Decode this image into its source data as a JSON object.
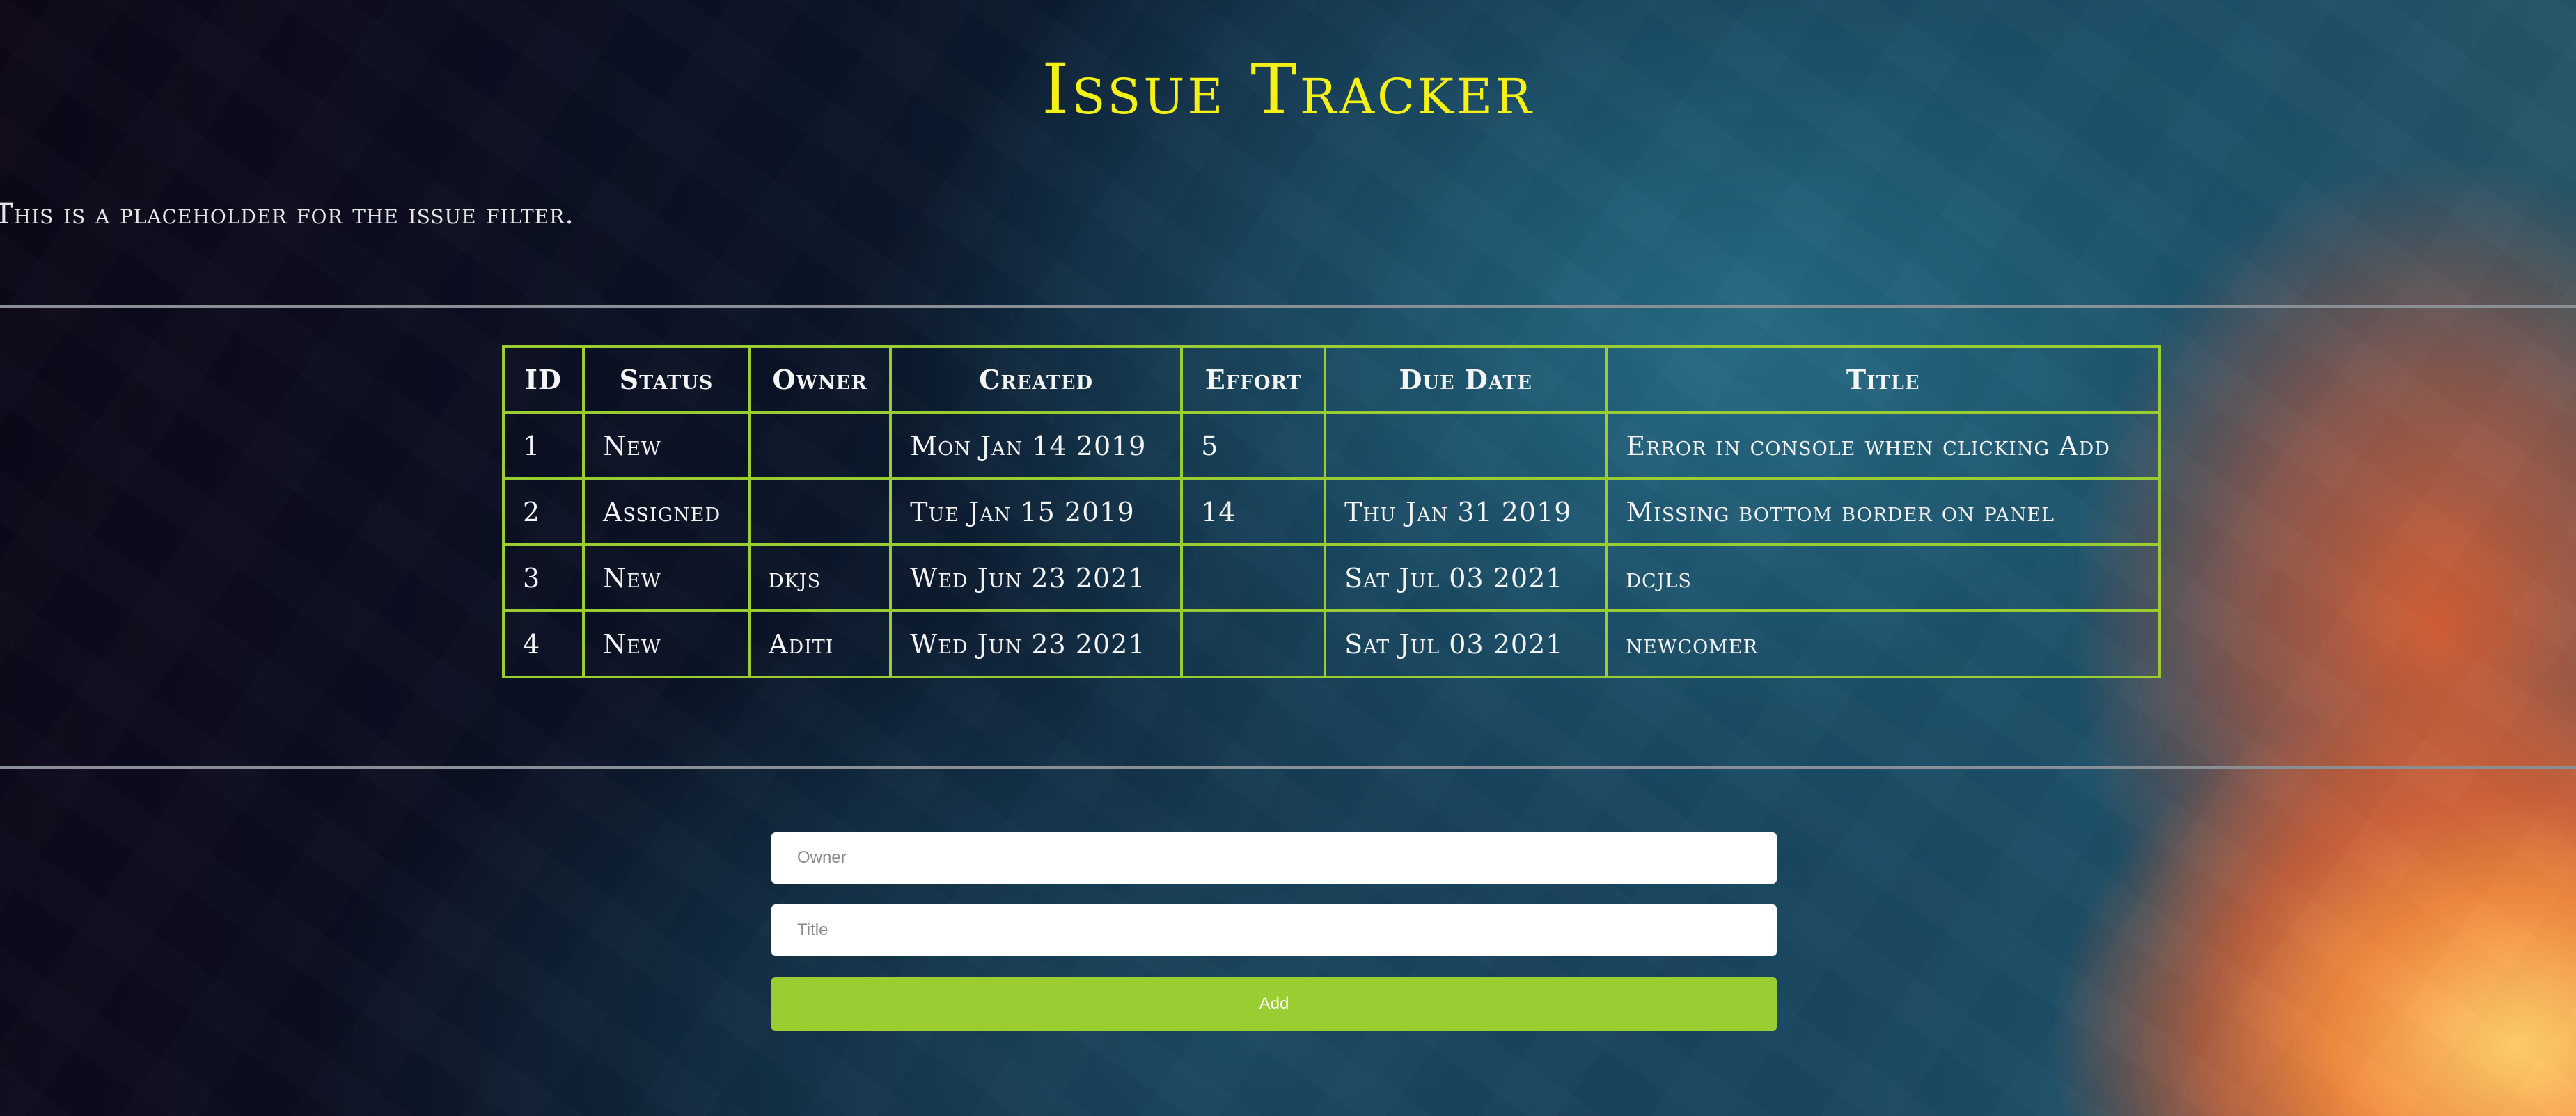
{
  "header": {
    "title": "Issue Tracker"
  },
  "filter": {
    "placeholder_text": "This is a placeholder for the issue filter."
  },
  "issue_table": {
    "columns": [
      "ID",
      "Status",
      "Owner",
      "Created",
      "Effort",
      "Due Date",
      "Title"
    ],
    "rows": [
      {
        "id": "1",
        "status": "New",
        "owner": "",
        "created": "Mon Jan 14 2019",
        "effort": "5",
        "due": "",
        "title": "Error in console when clicking Add"
      },
      {
        "id": "2",
        "status": "Assigned",
        "owner": "",
        "created": "Tue Jan 15 2019",
        "effort": "14",
        "due": "Thu Jan 31 2019",
        "title": "Missing bottom border on panel"
      },
      {
        "id": "3",
        "status": "New",
        "owner": "dkjs",
        "created": "Wed Jun 23 2021",
        "effort": "",
        "due": "Sat Jul 03 2021",
        "title": "dcjls"
      },
      {
        "id": "4",
        "status": "New",
        "owner": "Aditi",
        "created": "Wed Jun 23 2021",
        "effort": "",
        "due": "Sat Jul 03 2021",
        "title": "newcomer"
      }
    ]
  },
  "add_form": {
    "owner_placeholder": "Owner",
    "owner_value": "",
    "title_placeholder": "Title",
    "title_value": "",
    "add_label": "Add"
  },
  "colors": {
    "title": "#f5f116",
    "accent": "#9acd32",
    "divider": "#8a8f96"
  }
}
